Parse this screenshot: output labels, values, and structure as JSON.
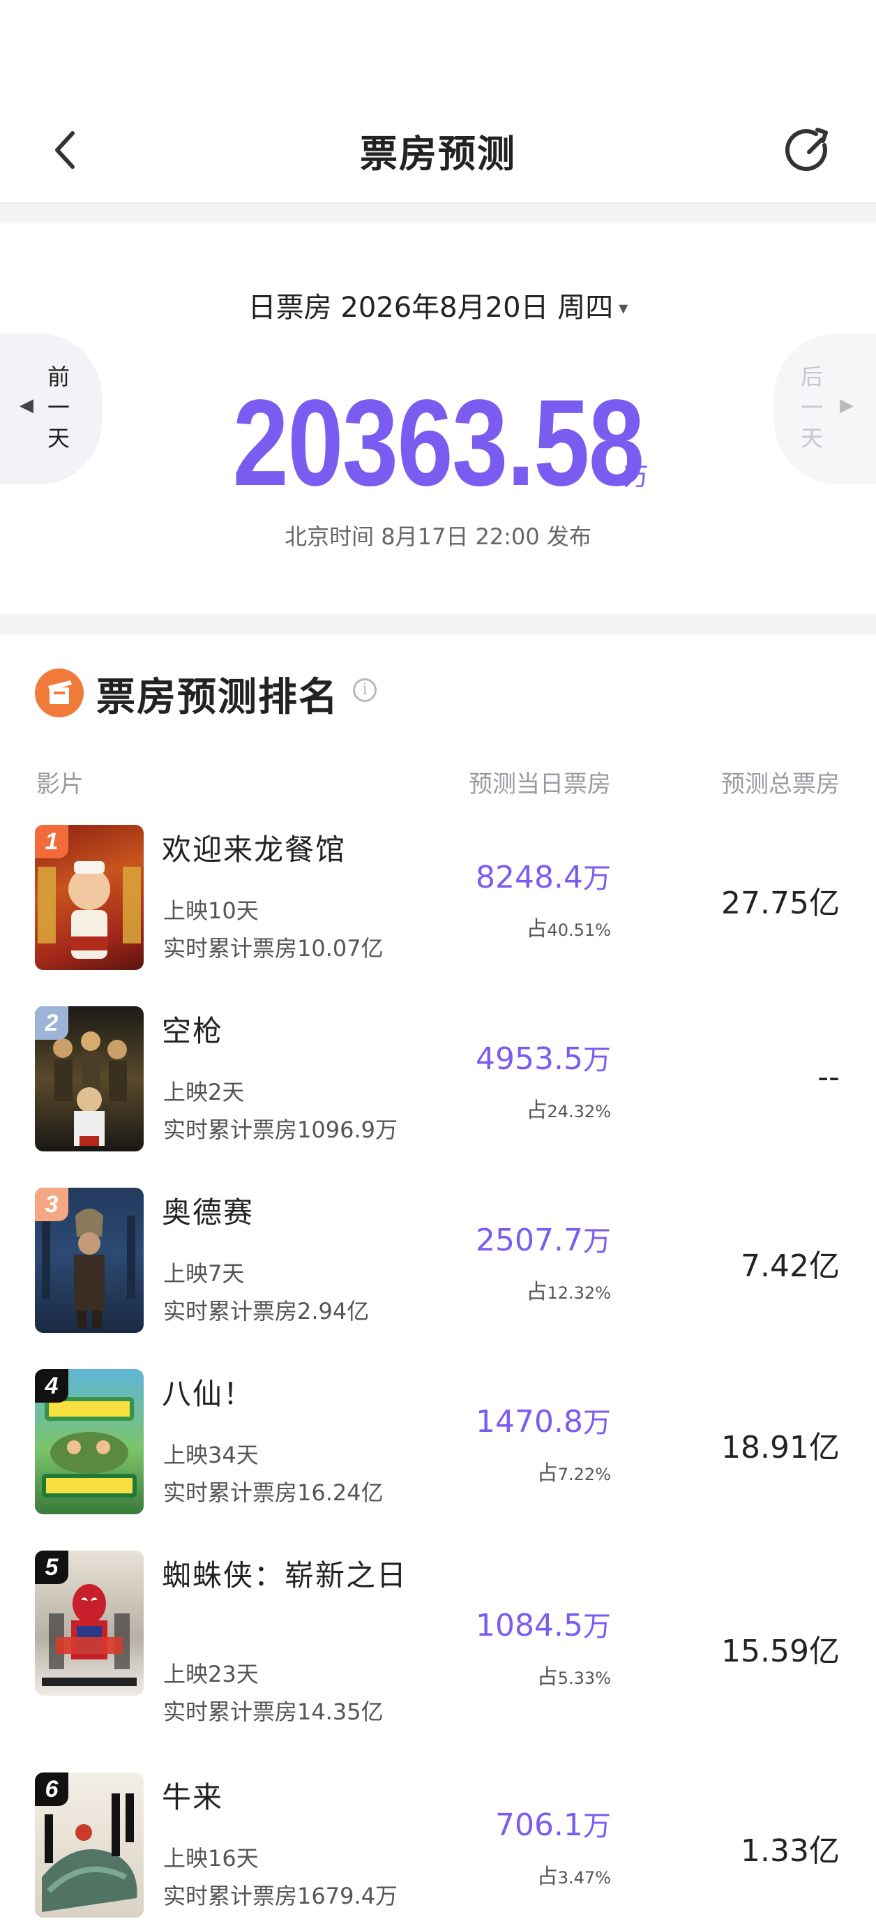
{
  "header": {
    "title": "票房预测"
  },
  "daily": {
    "label": "日票房 2026年8月20日 周四",
    "caret": "▾",
    "prev_label": [
      "前",
      "一",
      "天"
    ],
    "next_label": [
      "后",
      "一",
      "天"
    ],
    "amount": "20363.58",
    "unit": "万",
    "publish": "北京时间 8月17日 22:00 发布"
  },
  "ranking": {
    "title": "票房预测排名",
    "info": "i",
    "columns": {
      "film": "影片",
      "day": "预测当日票房",
      "total": "预测总票房"
    },
    "films": [
      {
        "rank": "1",
        "name": "欢迎来龙餐馆",
        "days": "上映10天",
        "cumulative": "实时累计票房10.07亿",
        "day_value": "8248.4",
        "day_unit": "万",
        "share_prefix": "占",
        "share": "40.51%",
        "total": "27.75",
        "total_unit": "亿",
        "badge_color": "#f26b3a"
      },
      {
        "rank": "2",
        "name": "空枪",
        "days": "上映2天",
        "cumulative": "实时累计票房1096.9万",
        "day_value": "4953.5",
        "day_unit": "万",
        "share_prefix": "占",
        "share": "24.32%",
        "total": "--",
        "total_unit": "",
        "badge_color": "#9db3d8"
      },
      {
        "rank": "3",
        "name": "奥德赛",
        "days": "上映7天",
        "cumulative": "实时累计票房2.94亿",
        "day_value": "2507.7",
        "day_unit": "万",
        "share_prefix": "占",
        "share": "12.32%",
        "total": "7.42",
        "total_unit": "亿",
        "badge_color": "#f4a780"
      },
      {
        "rank": "4",
        "name": "八仙！",
        "days": "上映34天",
        "cumulative": "实时累计票房16.24亿",
        "day_value": "1470.8",
        "day_unit": "万",
        "share_prefix": "占",
        "share": "7.22%",
        "total": "18.91",
        "total_unit": "亿",
        "badge_color": "#111111"
      },
      {
        "rank": "5",
        "name": "蜘蛛侠：崭新之日",
        "days": "上映23天",
        "cumulative": "实时累计票房14.35亿",
        "day_value": "1084.5",
        "day_unit": "万",
        "share_prefix": "占",
        "share": "5.33%",
        "total": "15.59",
        "total_unit": "亿",
        "badge_color": "#111111"
      },
      {
        "rank": "6",
        "name": "牛来",
        "days": "上映16天",
        "cumulative": "实时累计票房1679.4万",
        "day_value": "706.1",
        "day_unit": "万",
        "share_prefix": "占",
        "share": "3.47%",
        "total": "1.33",
        "total_unit": "亿",
        "badge_color": "#111111"
      }
    ]
  },
  "colors": {
    "accent": "#7b5cf0",
    "rank_icon": "#f07a3a"
  },
  "icons": [
    "chevron-left-icon",
    "refresh-icon",
    "triangle-down-icon",
    "triangle-left-icon",
    "triangle-right-icon",
    "film-ranking-icon",
    "info-icon"
  ]
}
